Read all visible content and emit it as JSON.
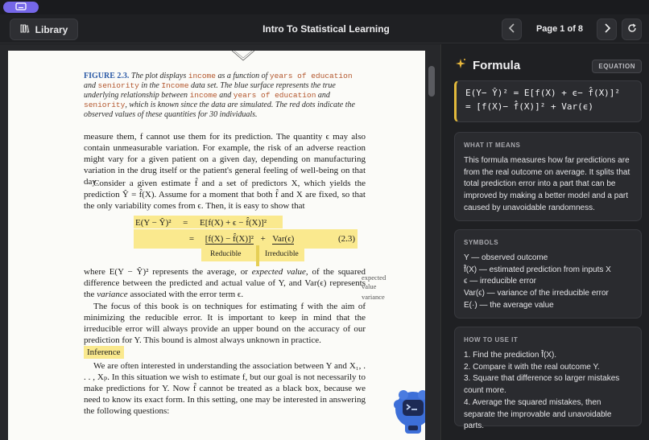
{
  "app": {
    "title": "Intro To Statistical Learning",
    "library_label": "Library",
    "page_indicator": "Page 1 of 8"
  },
  "icons": {
    "library": "library-icon",
    "prev": "chevron-left-icon",
    "next": "chevron-right-icon",
    "refresh": "refresh-icon",
    "sparkle": "sparkle-icon",
    "window": "window-icon"
  },
  "colors": {
    "accent": "#7567e8",
    "highlight": "#fae98e",
    "formula_border": "#e2b93b",
    "sparkle": "#e9b83c",
    "caption_label": "#2b5aa6",
    "caption_var": "#b3562c"
  },
  "document": {
    "caption": {
      "label": "FIGURE 2.3.",
      "t1": " The plot displays ",
      "v1": "income",
      "t2": " as a function of ",
      "v2": "years of education",
      "t3": " and ",
      "v3": "seniority",
      "t4": " in the ",
      "v4": "Income",
      "t5": " data set. The blue surface represents the true underlying relationship between ",
      "v5": "income",
      "t6": " and ",
      "v6": "years of education",
      "t7": " and ",
      "v7": "seniority",
      "t8": ", which is known since the data are simulated. The red dots indicate the observed values of these quantities for 30 individuals."
    },
    "para1": "measure them, f cannot use them for its prediction. The quantity ϵ may also contain unmeasurable variation. For example, the risk of an adverse reaction might vary for a given patient on a given day, depending on manufacturing variation in the drug itself or the patient's general feeling of well-being on that day.",
    "para2": "Consider a given estimate f̂ and a set of predictors X, which yields the prediction Ŷ = f̂(X). Assume for a moment that both f̂ and X are fixed, so that the only variability comes from ϵ. Then, it is easy to show that",
    "eq": {
      "line1_lhs": "E(Y − Ŷ)²",
      "line1_eq": "=",
      "line1_rhs": "E[f(X) + ϵ − f̂(X)]²",
      "line2_eq": "=",
      "line2_rhs_a": "[f(X) − f̂(X)]²",
      "line2_plus": "+",
      "line2_rhs_b": "Var(ϵ)",
      "number": "(2.3)",
      "reducible": "Reducible",
      "irreducible": "Irreducible"
    },
    "para3_a": "where E(Y − Ŷ)² represents the average, or ",
    "para3_em": "expected value",
    "para3_b": ", of the squared difference between the predicted and actual value of Y, and Var(ϵ) represents the ",
    "para3_em2": "variance",
    "para3_c": " associated with the error term ϵ.",
    "margin1": "expected value",
    "margin2": "variance",
    "para4": "The focus of this book is on techniques for estimating f with the aim of minimizing the reducible error. It is important to keep in mind that the irreducible error will always provide an upper bound on the accuracy of our prediction for Y. This bound is almost always unknown in practice.",
    "heading": "Inference",
    "para5": "We are often interested in understanding the association between Y and X₁, . . . , Xₚ. In this situation we wish to estimate f, but our goal is not necessarily to make predictions for Y. Now f̂ cannot be treated as a black box, because we need to know its exact form. In this setting, one may be interested in answering the following questions:"
  },
  "panel": {
    "title": "Formula",
    "tag": "EQUATION",
    "formula_line1": "E(Y− Ŷ)² = E[f(X) + ϵ− f̂(X)]²",
    "formula_line2": "= [f(X)− f̂(X)]² + Var(ϵ)",
    "meaning": {
      "label": "WHAT IT MEANS",
      "text": "This formula measures how far predictions are from the real outcome on average. It splits that total prediction error into a part that can be improved by making a better model and a part caused by unavoidable randomness."
    },
    "symbols": {
      "label": "SYMBOLS",
      "items": [
        "Y — observed outcome",
        "f̂(X) — estimated prediction from inputs X",
        "ϵ — irreducible error",
        "Var(ϵ) — variance of the irreducible error",
        "E(·) — the average value"
      ]
    },
    "howto": {
      "label": "HOW TO USE IT",
      "items": [
        "1. Find the prediction f̂(X).",
        "2. Compare it with the real outcome Y.",
        "3. Square that difference so larger mistakes count more.",
        "4. Average the squared mistakes, then separate the improvable and unavoidable parts."
      ]
    }
  }
}
